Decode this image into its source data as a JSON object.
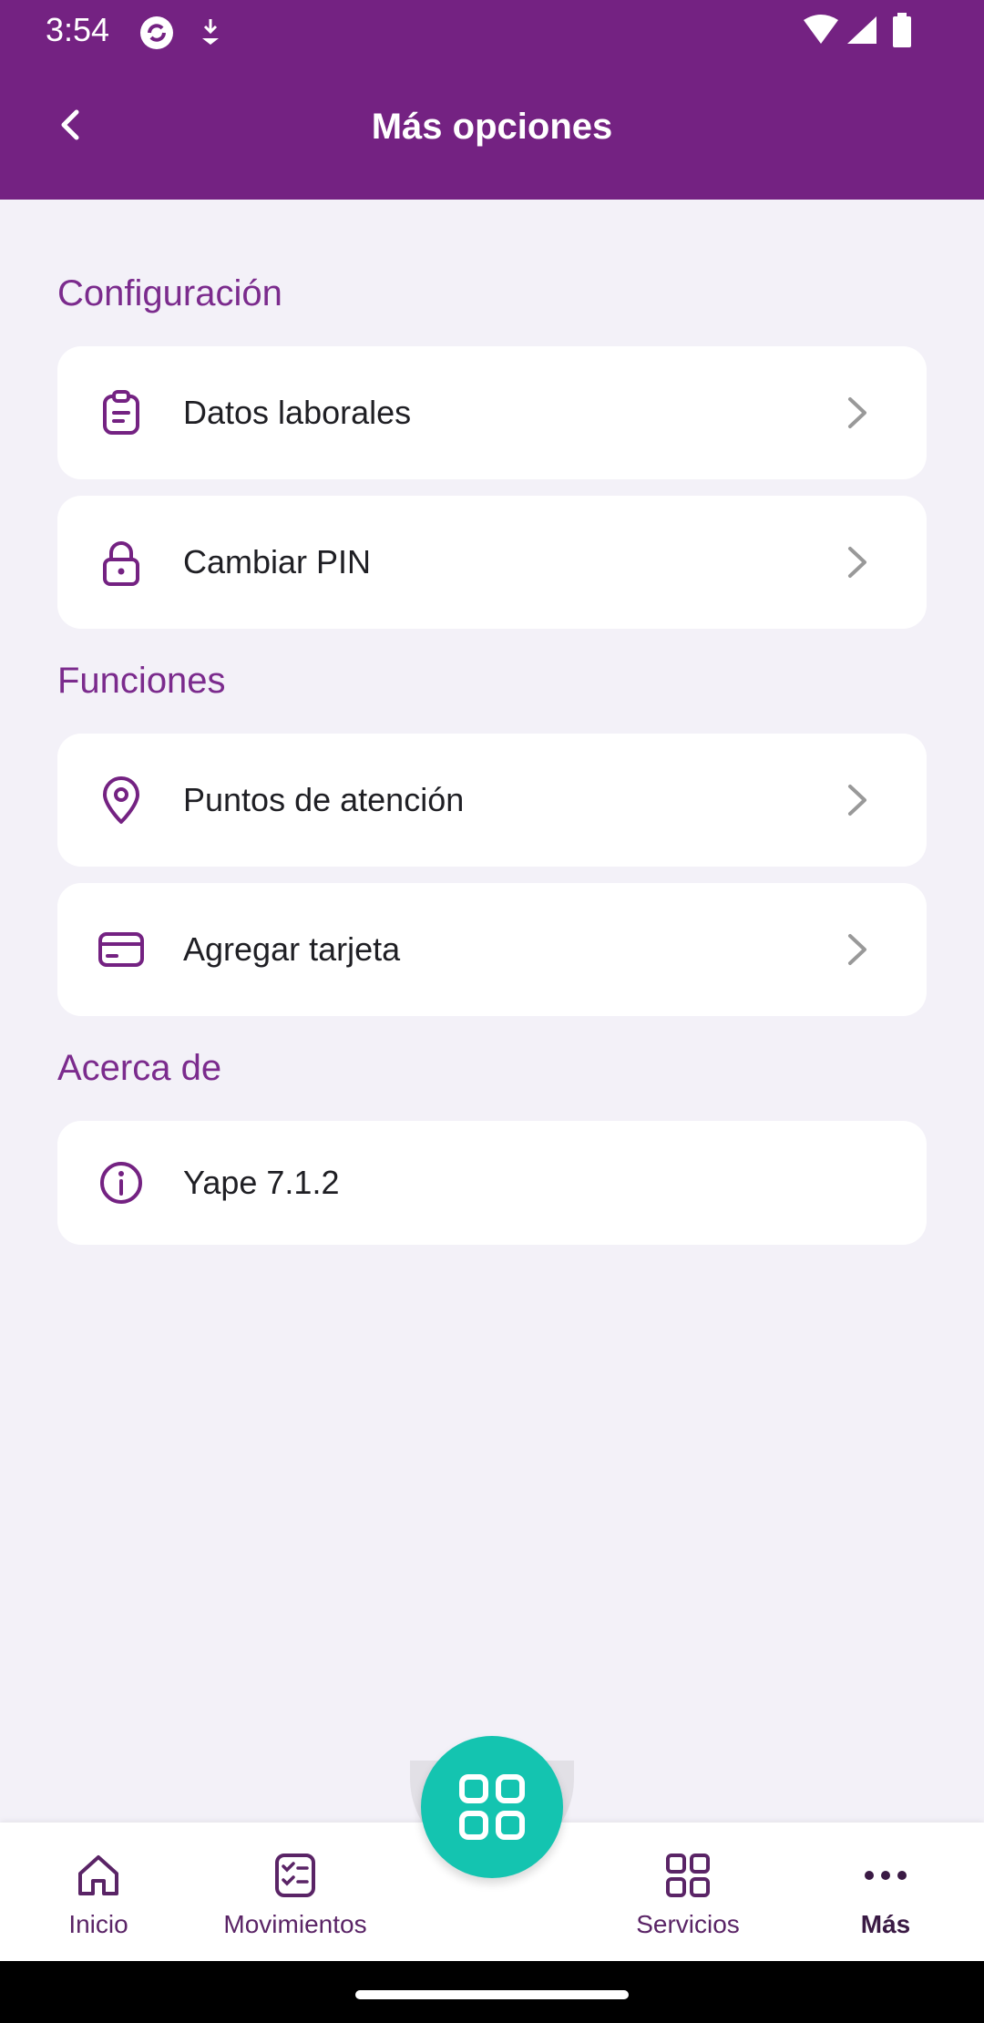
{
  "status_bar": {
    "time": "3:54"
  },
  "header": {
    "title": "Más opciones"
  },
  "sections": [
    {
      "title": "Configuración",
      "items": [
        {
          "label": "Datos laborales",
          "icon": "clipboard-icon"
        },
        {
          "label": "Cambiar PIN",
          "icon": "lock-icon"
        }
      ]
    },
    {
      "title": "Funciones",
      "items": [
        {
          "label": "Puntos de atención",
          "icon": "location-pin-icon"
        },
        {
          "label": "Agregar tarjeta",
          "icon": "credit-card-icon"
        }
      ]
    },
    {
      "title": "Acerca de",
      "items": [
        {
          "label": "Yape 7.1.2",
          "icon": "info-icon"
        }
      ]
    }
  ],
  "bottom_nav": {
    "items": [
      {
        "label": "Inicio",
        "icon": "home-icon"
      },
      {
        "label": "Movimientos",
        "icon": "checklist-icon"
      },
      {
        "label": "Servicios",
        "icon": "grid-icon"
      },
      {
        "label": "Más",
        "icon": "more-icon",
        "active": true
      }
    ],
    "fab_icon": "qr-scan-icon"
  },
  "colors": {
    "primary": "#742282",
    "accent": "#7b2b8d",
    "fab": "#14c4b0",
    "background": "#f3f1f8"
  }
}
